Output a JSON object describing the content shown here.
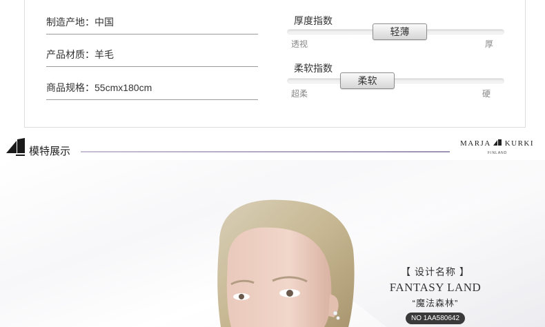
{
  "specs": {
    "origin": "制造产地：中国",
    "material": "产品材质：羊毛",
    "size": "商品规格：55cmx180cm"
  },
  "thickness": {
    "title": "厚度指数",
    "value_label": "轻薄",
    "min_label": "透视",
    "max_label": "厚",
    "level": 0.52
  },
  "softness": {
    "title": "柔软指数",
    "value_label": "柔软",
    "min_label": "超柔",
    "max_label": "硬",
    "level": 0.37
  },
  "section": {
    "title": "模特展示",
    "line_color": "#9c92b5"
  },
  "brand": {
    "name": "MARJA KURKI",
    "sub": "FINLAND"
  },
  "design": {
    "label": "【 设计名称 】",
    "name": "FANTASY LAND",
    "cn_name": "“魔法森林”",
    "number": "NO 1AA580642"
  }
}
